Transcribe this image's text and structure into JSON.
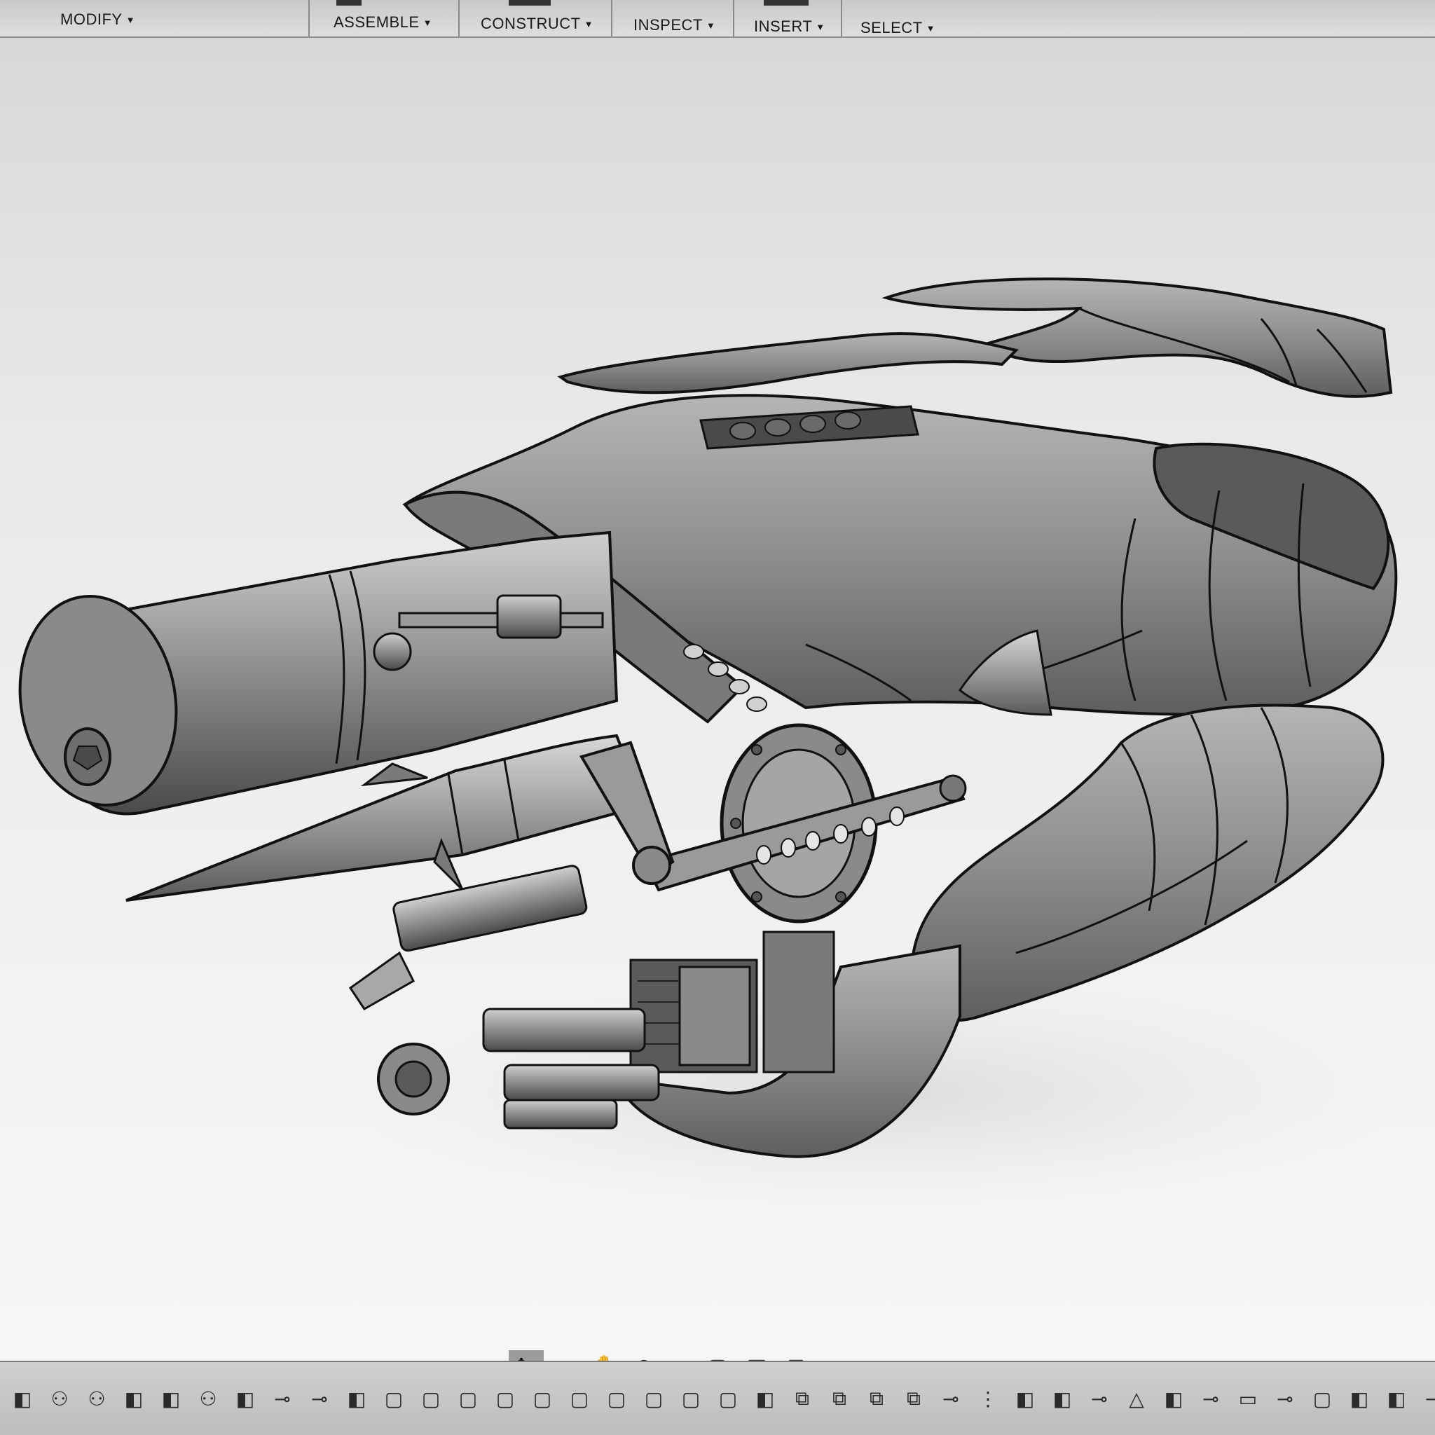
{
  "toolbar": {
    "menus": [
      {
        "label": "MODIFY"
      },
      {
        "label": "ASSEMBLE"
      },
      {
        "label": "CONSTRUCT"
      },
      {
        "label": "INSPECT"
      },
      {
        "label": "INSERT"
      },
      {
        "label": "SELECT"
      }
    ]
  },
  "navbar": {
    "tools": [
      "orbit-icon",
      "look-at-icon",
      "pan-icon",
      "zoom-icon",
      "fit-icon",
      "display-settings-icon",
      "grid-icon",
      "viewports-icon"
    ]
  },
  "timeline": {
    "features": [
      "box",
      "joint",
      "joint",
      "box",
      "box",
      "joint",
      "box",
      "move",
      "move",
      "box",
      "sketch",
      "sketch",
      "sketch",
      "sketch",
      "sketch",
      "sketch",
      "sketch",
      "sketch",
      "sketch",
      "sketch",
      "box",
      "component",
      "component",
      "component",
      "component",
      "move",
      "marker",
      "box",
      "box",
      "move",
      "triangle",
      "box",
      "move",
      "plane",
      "move",
      "sketch",
      "box",
      "box",
      "move"
    ]
  },
  "colors": {
    "background": "#f0f0f0",
    "toolbar": "#d0d0d0",
    "model_body": "#8c8c8c",
    "line": "#141414"
  }
}
